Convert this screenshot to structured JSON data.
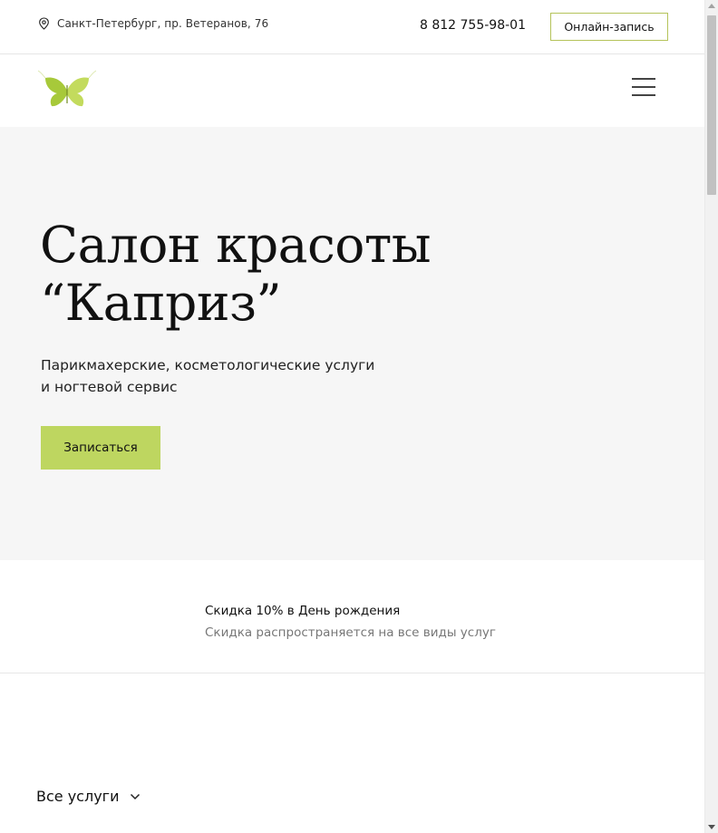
{
  "header": {
    "address": "Санкт-Петербург, пр. Ветеранов, 76",
    "phone": "8 812 755-98-01",
    "online_booking_label": "Онлайн-запись"
  },
  "nav": {
    "logo_icon": "butterfly-logo",
    "menu_icon": "hamburger-menu-icon"
  },
  "hero": {
    "title_line1": "Салон красоты",
    "title_line2": "“Каприз”",
    "subtitle_line1": "Парикмахерские, косметологические услуги",
    "subtitle_line2": "и ногтевой сервис",
    "cta_label": "Записаться"
  },
  "promo": {
    "title": "Скидка 10% в День рождения",
    "description": "Скидка распространяется на все виды услуг"
  },
  "services": {
    "toggle_label": "Все услуги"
  },
  "colors": {
    "accent": "#bed660",
    "hero_bg": "#f6f6f6",
    "button_border": "#b5c35a"
  }
}
